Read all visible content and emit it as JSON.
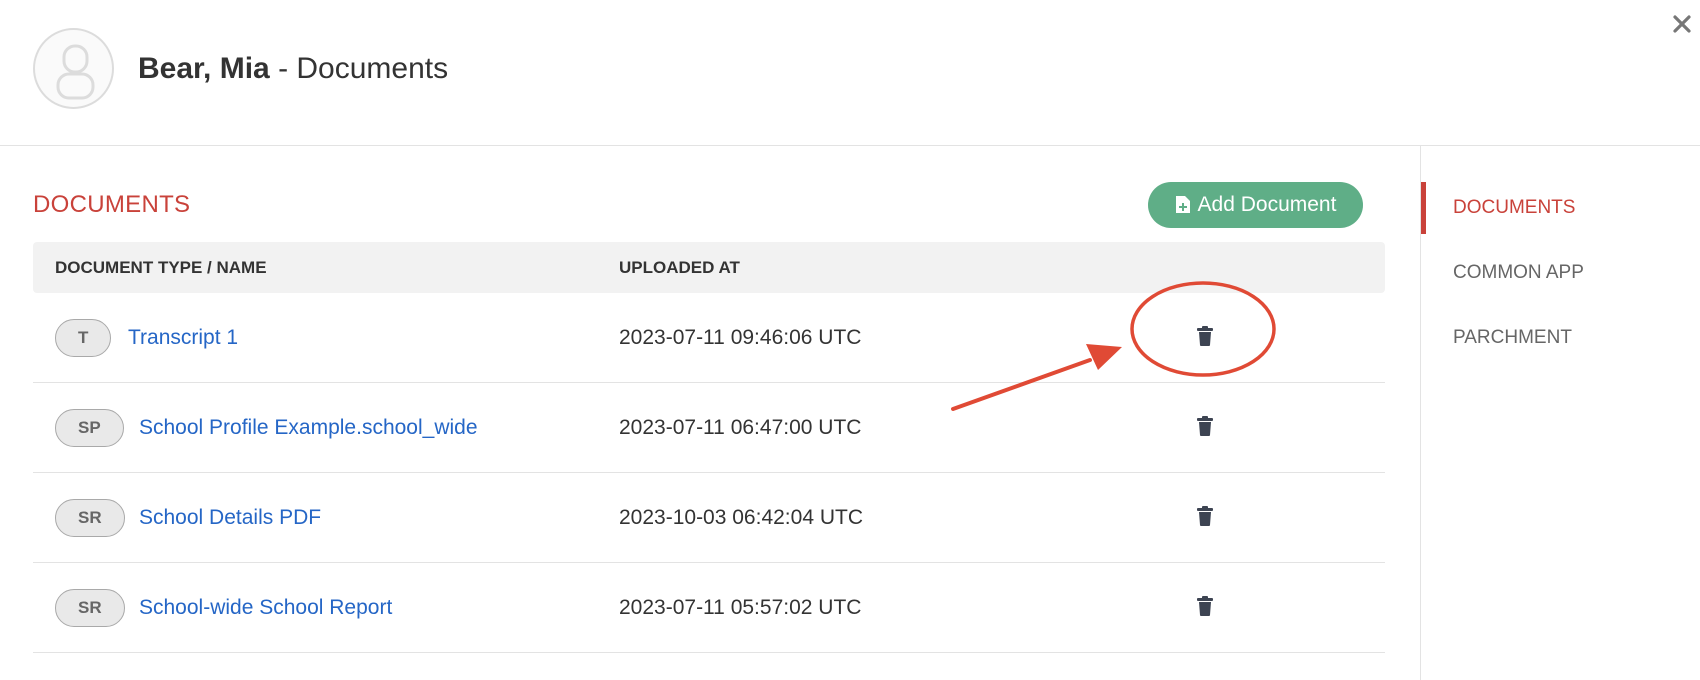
{
  "header": {
    "student_name": "Bear, Mia",
    "title_suffix": " - Documents"
  },
  "main": {
    "section_title": "DOCUMENTS",
    "add_button_label": "Add Document",
    "columns": {
      "name": "DOCUMENT TYPE / NAME",
      "uploaded": "UPLOADED AT"
    },
    "documents": [
      {
        "badge": "T",
        "name": "Transcript 1",
        "uploaded_at": "2023-07-11 09:46:06 UTC"
      },
      {
        "badge": "SP",
        "name": "School Profile Example.school_wide",
        "uploaded_at": "2023-07-11 06:47:00 UTC"
      },
      {
        "badge": "SR",
        "name": "School Details PDF",
        "uploaded_at": "2023-10-03 06:42:04 UTC"
      },
      {
        "badge": "SR",
        "name": "School-wide School Report",
        "uploaded_at": "2023-07-11 05:57:02 UTC"
      }
    ]
  },
  "sidenav": {
    "items": [
      {
        "label": "DOCUMENTS",
        "active": true
      },
      {
        "label": "COMMON APP",
        "active": false
      },
      {
        "label": "PARCHMENT",
        "active": false
      }
    ]
  },
  "icons": {
    "close": "close-icon",
    "avatar": "user-placeholder-icon",
    "add": "file-plus-icon",
    "delete": "trash-icon"
  },
  "colors": {
    "accent_red": "#c9423a",
    "add_button_green": "#5fae87",
    "link_blue": "#2566c6",
    "annotation_red": "#e04a35"
  }
}
